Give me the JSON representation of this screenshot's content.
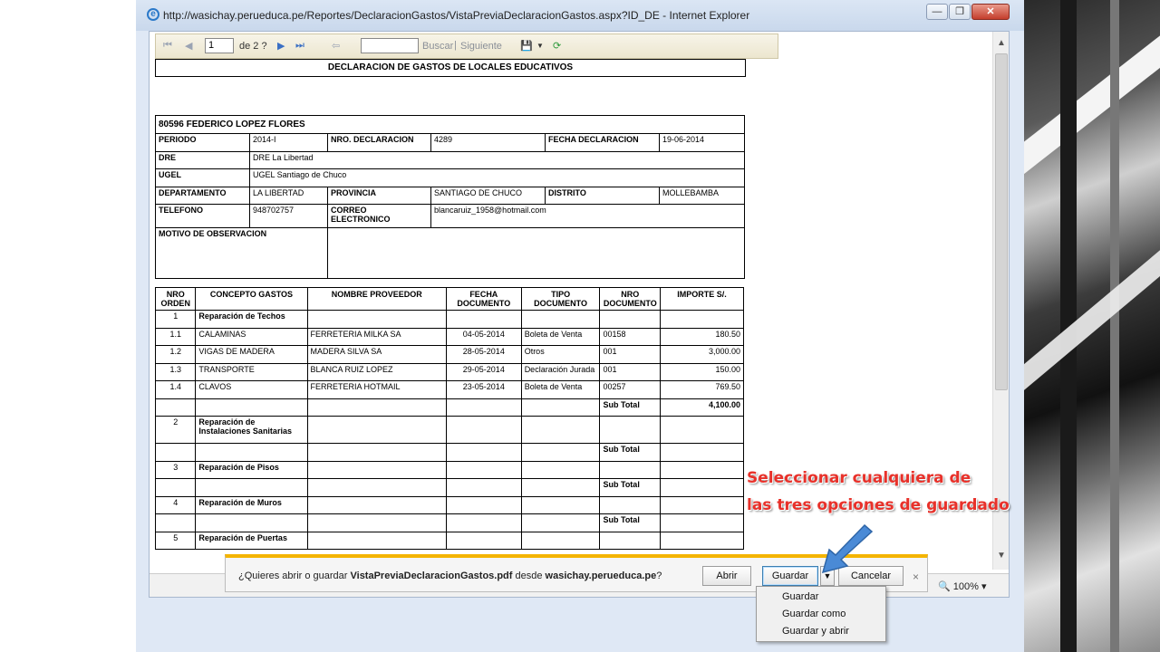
{
  "browser": {
    "title": "http://wasichay.perueduca.pe/Reportes/DeclaracionGastos/VistaPreviaDeclaracionGastos.aspx?ID_DE - Internet Explorer",
    "min_label": "—",
    "max_label": "❐",
    "close_label": "✕",
    "zoom": "100%"
  },
  "toolbar": {
    "page": "1",
    "of_pages": "de 2 ?",
    "search_label": "Buscar",
    "separator": "|",
    "next_label": "Siguiente"
  },
  "report": {
    "title": "DECLARACION DE GASTOS DE LOCALES EDUCATIVOS",
    "header": {
      "name": "80596 FEDERICO LOPEZ FLORES",
      "periodo_k": "PERIODO",
      "periodo_v": "2014-I",
      "nro_decl_k": "NRO. DECLARACION",
      "nro_decl_v": "4289",
      "fecha_decl_k": "FECHA DECLARACION",
      "fecha_decl_v": "19-06-2014",
      "dre_k": "DRE",
      "dre_v": "DRE La Libertad",
      "ugel_k": "UGEL",
      "ugel_v": "UGEL Santiago de Chuco",
      "depto_k": "DEPARTAMENTO",
      "depto_v": "LA LIBERTAD",
      "prov_k": "PROVINCIA",
      "prov_v": "SANTIAGO DE CHUCO",
      "dist_k": "DISTRITO",
      "dist_v": "MOLLEBAMBA",
      "tel_k": "TELEFONO",
      "tel_v": "948702757",
      "correo_k": "CORREO ELECTRONICO",
      "correo_v": "blancaruiz_1958@hotmail.com",
      "motivo_k": "MOTIVO DE OBSERVACION"
    },
    "columns": [
      "NRO ORDEN",
      "CONCEPTO GASTOS",
      "NOMBRE PROVEEDOR",
      "FECHA DOCUMENTO",
      "TIPO DOCUMENTO",
      "NRO DOCUMENTO",
      "IMPORTE S/."
    ],
    "rows": [
      {
        "orden": "1",
        "concepto": "Reparación de Techos"
      },
      {
        "orden": "1.1",
        "concepto": "CALAMINAS",
        "proveedor": "FERRETERIA MILKA SA",
        "fecha": "04-05-2014",
        "tipo": "Boleta de Venta",
        "nro": "00158",
        "importe": "180.50"
      },
      {
        "orden": "1.2",
        "concepto": "VIGAS DE MADERA",
        "proveedor": "MADERA SILVA SA",
        "fecha": "28-05-2014",
        "tipo": "Otros",
        "nro": "001",
        "importe": "3,000.00"
      },
      {
        "orden": "1.3",
        "concepto": "TRANSPORTE",
        "proveedor": "BLANCA RUIZ LOPEZ",
        "fecha": "29-05-2014",
        "tipo": "Declaración Jurada",
        "nro": "001",
        "importe": "150.00"
      },
      {
        "orden": "1.4",
        "concepto": "CLAVOS",
        "proveedor": "FERRETERIA HOTMAIL",
        "fecha": "23-05-2014",
        "tipo": "Boleta de Venta",
        "nro": "00257",
        "importe": "769.50"
      },
      {
        "subtotal": "Sub Total",
        "importe": "4,100.00"
      },
      {
        "orden": "2",
        "concepto": "Reparación de Instalaciones Sanitarias"
      },
      {
        "subtotal": "Sub Total"
      },
      {
        "orden": "3",
        "concepto": "Reparación de Pisos"
      },
      {
        "subtotal": "Sub Total"
      },
      {
        "orden": "4",
        "concepto": "Reparación de Muros"
      },
      {
        "subtotal": "Sub Total"
      },
      {
        "orden": "5",
        "concepto": "Reparación de Puertas"
      }
    ]
  },
  "download_bar": {
    "msg_pre": "¿Quieres abrir o guardar ",
    "file": "VistaPreviaDeclaracionGastos.pdf",
    "msg_mid": " desde ",
    "site": "wasichay.perueduca.pe",
    "msg_post": "?",
    "open": "Abrir",
    "save": "Guardar",
    "cancel": "Cancelar",
    "close": "×"
  },
  "save_menu": [
    "Guardar",
    "Guardar como",
    "Guardar y abrir"
  ],
  "annotation": {
    "line1": "Seleccionar cualquiera de",
    "line2": "las tres opciones de guardado",
    "color": "#e8312a"
  }
}
